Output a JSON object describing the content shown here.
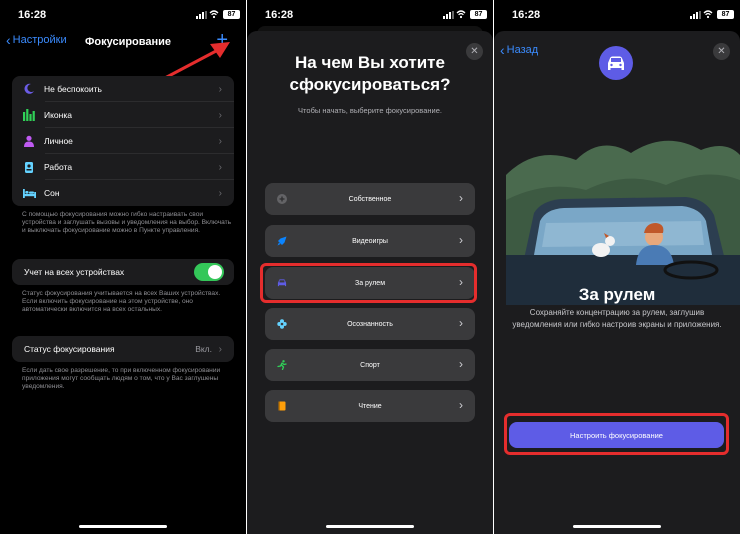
{
  "status": {
    "time": "16:28",
    "battery": "87"
  },
  "screen1": {
    "back_label": "Настройки",
    "title": "Фокусирование",
    "add_symbol": "+",
    "modes": [
      {
        "label": "Не беспокоить",
        "icon": "moon-icon",
        "color": "#6b5ce6"
      },
      {
        "label": "Иконка",
        "icon": "bars-icon",
        "color": "#30d158"
      },
      {
        "label": "Личное",
        "icon": "person-icon",
        "color": "#bf5af2"
      },
      {
        "label": "Работа",
        "icon": "badge-icon",
        "color": "#64d2ff"
      },
      {
        "label": "Сон",
        "icon": "bed-icon",
        "color": "#64d2ff"
      }
    ],
    "modes_footer": "С помощью фокусирования можно гибко настраивать свои устройства и заглушать вызовы и уведомления на выбор. Включать и выключать фокусирование можно в Пункте управления.",
    "share_label": "Учет на всех устройствах",
    "share_on": true,
    "share_footer": "Статус фокусирования учитывается на всех Ваших устройствах. Если включить фокусирование на этом устройстве, оно автоматически включится на всех остальных.",
    "status_label": "Статус фокусирования",
    "status_value": "Вкл.",
    "status_footer": "Если дать свое разрешение, то при включенном фокусировании приложения могут сообщать людям о том, что у Вас заглушены уведомления."
  },
  "screen2": {
    "title": "На чем Вы хотите сфокусироваться?",
    "subtitle": "Чтобы начать, выберите фокусирование.",
    "options": [
      {
        "label": "Собственное",
        "icon": "plus-circle-icon",
        "color": "#8e8e93"
      },
      {
        "label": "Видеоигры",
        "icon": "rocket-icon",
        "color": "#0a84ff"
      },
      {
        "label": "За рулем",
        "icon": "car-icon",
        "color": "#5e5ce6"
      },
      {
        "label": "Осознанность",
        "icon": "flower-icon",
        "color": "#64d2ff"
      },
      {
        "label": "Спорт",
        "icon": "running-icon",
        "color": "#30d158"
      },
      {
        "label": "Чтение",
        "icon": "book-icon",
        "color": "#ff9f0a"
      }
    ]
  },
  "screen3": {
    "back_label": "Назад",
    "title": "За рулем",
    "description": "Сохраняйте концентрацию за рулем, заглушив уведомления или гибко настроив экраны и приложения.",
    "cta_label": "Настроить фокусирование"
  },
  "colors": {
    "accent": "#3b8cff",
    "purple": "#5e5ce6",
    "highlight": "#e52d2d",
    "toggle": "#34c759"
  }
}
